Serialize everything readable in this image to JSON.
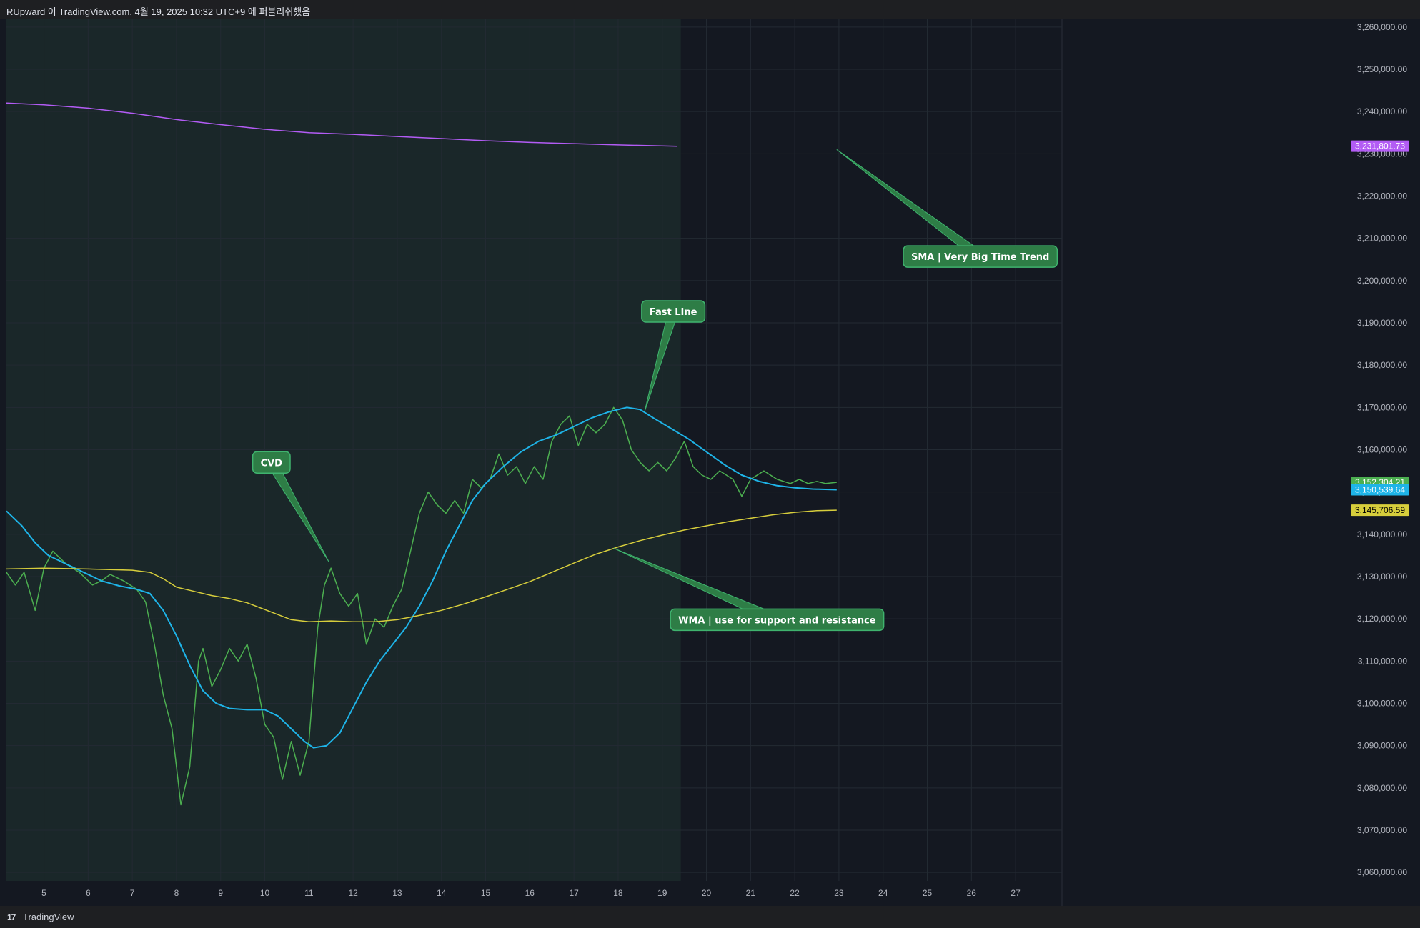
{
  "header": {
    "title": "RUpward 이 TradingView.com, 4월 19, 2025 10:32 UTC+9 에 퍼블리쉬했음"
  },
  "footer": {
    "brand": "TradingView",
    "logo": "17"
  },
  "colors": {
    "background": "#141821",
    "highlight": "#1a2729",
    "sma": "#b35cf5",
    "fast": "#1eb4e8",
    "wma": "#d7ce3c",
    "cvd": "#4caf50",
    "callout": "#2e7d46",
    "callout_border": "#3fb36e"
  },
  "chart_data": {
    "type": "line",
    "title": "",
    "xlabel": "",
    "ylabel": "",
    "x_ticks": [
      "5",
      "6",
      "7",
      "8",
      "9",
      "10",
      "11",
      "12",
      "13",
      "14",
      "15",
      "16",
      "17",
      "18",
      "19",
      "20",
      "21",
      "22",
      "23",
      "24",
      "25",
      "26",
      "27"
    ],
    "x_range": [
      4.15,
      28.05
    ],
    "y_range": [
      3058000,
      3262000
    ],
    "y_ticks": [
      3060000,
      3070000,
      3080000,
      3090000,
      3100000,
      3110000,
      3120000,
      3130000,
      3140000,
      3150000,
      3160000,
      3170000,
      3180000,
      3190000,
      3200000,
      3210000,
      3220000,
      3230000,
      3240000,
      3250000,
      3260000
    ],
    "y_tick_labels": [
      "3,060,000.00",
      "3,070,000.00",
      "3,080,000.00",
      "3,090,000.00",
      "3,100,000.00",
      "3,110,000.00",
      "3,120,000.00",
      "3,130,000.00",
      "3,140,000.00",
      "3,150,000.00",
      "3,160,000.00",
      "3,170,000.00",
      "3,180,000.00",
      "3,190,000.00",
      "3,200,000.00",
      "3,210,000.00",
      "3,220,000.00",
      "3,230,000.00",
      "3,240,000.00",
      "3,250,000.00",
      "3,260,000.00"
    ],
    "highlight_range": [
      4.15,
      19.42
    ],
    "grid": true,
    "series": [
      {
        "key": "sma",
        "color": "#b35cf5",
        "last_label": "3,231,801.73",
        "last_value": 3231801.73,
        "points": [
          [
            4.15,
            3242000
          ],
          [
            5.0,
            3241600
          ],
          [
            6.0,
            3240800
          ],
          [
            7.0,
            3239600
          ],
          [
            8.0,
            3238100
          ],
          [
            9.0,
            3236900
          ],
          [
            10.0,
            3235800
          ],
          [
            11.0,
            3235000
          ],
          [
            12.0,
            3234600
          ],
          [
            13.0,
            3234100
          ],
          [
            14.0,
            3233600
          ],
          [
            15.0,
            3233100
          ],
          [
            16.0,
            3232700
          ],
          [
            17.0,
            3232400
          ],
          [
            18.0,
            3232100
          ],
          [
            19.33,
            3231800
          ]
        ]
      },
      {
        "key": "cvd",
        "color": "#4caf50",
        "last_label": "3,152,304.21",
        "last_value": 3152304.21,
        "points": [
          [
            4.15,
            3131000
          ],
          [
            4.35,
            3128000
          ],
          [
            4.55,
            3131000
          ],
          [
            4.8,
            3122000
          ],
          [
            5.0,
            3132000
          ],
          [
            5.2,
            3136000
          ],
          [
            5.5,
            3133000
          ],
          [
            5.8,
            3131000
          ],
          [
            6.1,
            3128000
          ],
          [
            6.3,
            3129000
          ],
          [
            6.5,
            3130500
          ],
          [
            6.8,
            3129000
          ],
          [
            7.1,
            3127000
          ],
          [
            7.3,
            3124000
          ],
          [
            7.5,
            3114000
          ],
          [
            7.7,
            3102000
          ],
          [
            7.9,
            3094000
          ],
          [
            8.1,
            3076000
          ],
          [
            8.3,
            3085000
          ],
          [
            8.5,
            3110000
          ],
          [
            8.6,
            3113000
          ],
          [
            8.8,
            3104000
          ],
          [
            9.0,
            3108000
          ],
          [
            9.2,
            3113000
          ],
          [
            9.4,
            3110000
          ],
          [
            9.6,
            3114000
          ],
          [
            9.8,
            3106000
          ],
          [
            10.0,
            3095000
          ],
          [
            10.2,
            3092000
          ],
          [
            10.4,
            3082000
          ],
          [
            10.6,
            3091000
          ],
          [
            10.8,
            3083000
          ],
          [
            11.0,
            3091000
          ],
          [
            11.2,
            3118000
          ],
          [
            11.35,
            3128000
          ],
          [
            11.5,
            3132000
          ],
          [
            11.7,
            3126000
          ],
          [
            11.9,
            3123000
          ],
          [
            12.1,
            3126000
          ],
          [
            12.3,
            3114000
          ],
          [
            12.5,
            3120000
          ],
          [
            12.7,
            3118000
          ],
          [
            12.9,
            3123000
          ],
          [
            13.1,
            3127000
          ],
          [
            13.3,
            3136000
          ],
          [
            13.5,
            3145000
          ],
          [
            13.7,
            3150000
          ],
          [
            13.9,
            3147000
          ],
          [
            14.1,
            3145000
          ],
          [
            14.3,
            3148000
          ],
          [
            14.5,
            3145000
          ],
          [
            14.7,
            3153000
          ],
          [
            14.9,
            3151000
          ],
          [
            15.1,
            3153000
          ],
          [
            15.3,
            3159000
          ],
          [
            15.5,
            3154000
          ],
          [
            15.7,
            3156000
          ],
          [
            15.9,
            3152000
          ],
          [
            16.1,
            3156000
          ],
          [
            16.3,
            3153000
          ],
          [
            16.5,
            3162000
          ],
          [
            16.7,
            3166000
          ],
          [
            16.9,
            3168000
          ],
          [
            17.1,
            3161000
          ],
          [
            17.3,
            3166000
          ],
          [
            17.5,
            3164000
          ],
          [
            17.7,
            3166000
          ],
          [
            17.9,
            3170000
          ],
          [
            18.1,
            3167000
          ],
          [
            18.3,
            3160000
          ],
          [
            18.5,
            3157000
          ],
          [
            18.7,
            3155000
          ],
          [
            18.9,
            3157000
          ],
          [
            19.1,
            3155000
          ],
          [
            19.3,
            3158000
          ],
          [
            19.5,
            3162000
          ],
          [
            19.7,
            3156000
          ],
          [
            19.9,
            3154000
          ],
          [
            20.1,
            3153000
          ],
          [
            20.3,
            3155000
          ],
          [
            20.6,
            3153000
          ],
          [
            20.8,
            3149000
          ],
          [
            21.0,
            3153000
          ],
          [
            21.3,
            3155000
          ],
          [
            21.6,
            3153000
          ],
          [
            21.9,
            3152000
          ],
          [
            22.1,
            3153000
          ],
          [
            22.3,
            3152000
          ],
          [
            22.5,
            3152500
          ],
          [
            22.7,
            3152000
          ],
          [
            22.95,
            3152300
          ]
        ]
      },
      {
        "key": "fast",
        "color": "#1eb4e8",
        "last_label": "3,150,539.64",
        "last_value": 3150539.64,
        "points": [
          [
            4.15,
            3145500
          ],
          [
            4.5,
            3142000
          ],
          [
            4.8,
            3138000
          ],
          [
            5.1,
            3135000
          ],
          [
            5.5,
            3133000
          ],
          [
            5.9,
            3131000
          ],
          [
            6.3,
            3129000
          ],
          [
            6.7,
            3127800
          ],
          [
            7.1,
            3127000
          ],
          [
            7.4,
            3126000
          ],
          [
            7.7,
            3122000
          ],
          [
            8.0,
            3116000
          ],
          [
            8.3,
            3109000
          ],
          [
            8.6,
            3103000
          ],
          [
            8.9,
            3100000
          ],
          [
            9.2,
            3098800
          ],
          [
            9.6,
            3098500
          ],
          [
            10.0,
            3098500
          ],
          [
            10.3,
            3097000
          ],
          [
            10.6,
            3094000
          ],
          [
            10.9,
            3091000
          ],
          [
            11.1,
            3089500
          ],
          [
            11.4,
            3090000
          ],
          [
            11.7,
            3093000
          ],
          [
            12.0,
            3099000
          ],
          [
            12.3,
            3105000
          ],
          [
            12.6,
            3110000
          ],
          [
            12.9,
            3114000
          ],
          [
            13.2,
            3118000
          ],
          [
            13.5,
            3123000
          ],
          [
            13.8,
            3129000
          ],
          [
            14.1,
            3136000
          ],
          [
            14.4,
            3142000
          ],
          [
            14.7,
            3148000
          ],
          [
            15.0,
            3152000
          ],
          [
            15.4,
            3156000
          ],
          [
            15.8,
            3159500
          ],
          [
            16.2,
            3162000
          ],
          [
            16.6,
            3163500
          ],
          [
            17.0,
            3165500
          ],
          [
            17.4,
            3167500
          ],
          [
            17.8,
            3169000
          ],
          [
            18.2,
            3170000
          ],
          [
            18.5,
            3169500
          ],
          [
            18.8,
            3167500
          ],
          [
            19.2,
            3165000
          ],
          [
            19.6,
            3162500
          ],
          [
            20.0,
            3159500
          ],
          [
            20.4,
            3156500
          ],
          [
            20.8,
            3154000
          ],
          [
            21.2,
            3152500
          ],
          [
            21.6,
            3151500
          ],
          [
            22.0,
            3151000
          ],
          [
            22.4,
            3150700
          ],
          [
            22.95,
            3150540
          ]
        ]
      },
      {
        "key": "wma",
        "color": "#d7ce3c",
        "last_label": "3,145,706.59",
        "last_value": 3145706.59,
        "points": [
          [
            4.15,
            3131800
          ],
          [
            5.0,
            3132000
          ],
          [
            6.0,
            3131800
          ],
          [
            7.0,
            3131500
          ],
          [
            7.4,
            3131000
          ],
          [
            7.7,
            3129500
          ],
          [
            8.0,
            3127500
          ],
          [
            8.4,
            3126500
          ],
          [
            8.8,
            3125500
          ],
          [
            9.2,
            3124800
          ],
          [
            9.6,
            3123800
          ],
          [
            10.0,
            3122200
          ],
          [
            10.3,
            3121000
          ],
          [
            10.6,
            3119800
          ],
          [
            11.0,
            3119300
          ],
          [
            11.5,
            3119500
          ],
          [
            12.0,
            3119300
          ],
          [
            12.5,
            3119300
          ],
          [
            13.0,
            3119800
          ],
          [
            13.5,
            3120800
          ],
          [
            14.0,
            3122000
          ],
          [
            14.5,
            3123500
          ],
          [
            15.0,
            3125200
          ],
          [
            15.5,
            3127000
          ],
          [
            16.0,
            3128800
          ],
          [
            16.5,
            3131000
          ],
          [
            17.0,
            3133200
          ],
          [
            17.5,
            3135300
          ],
          [
            18.0,
            3137000
          ],
          [
            18.5,
            3138500
          ],
          [
            19.0,
            3139800
          ],
          [
            19.5,
            3141000
          ],
          [
            20.0,
            3142000
          ],
          [
            20.5,
            3143000
          ],
          [
            21.0,
            3143800
          ],
          [
            21.5,
            3144600
          ],
          [
            22.0,
            3145200
          ],
          [
            22.5,
            3145600
          ],
          [
            22.95,
            3145706
          ]
        ]
      }
    ],
    "annotations": [
      {
        "key": "cvd",
        "text": "CVD",
        "tip": [
          11.45,
          3133500
        ],
        "box_center": [
          10.15,
          3157000
        ]
      },
      {
        "key": "fast",
        "text": "Fast LIne",
        "tip": [
          18.6,
          3169000
        ],
        "box_center": [
          19.25,
          3192700
        ]
      },
      {
        "key": "sma",
        "text": "SMA | Very Big  Time Trend",
        "tip": [
          22.95,
          3231000
        ],
        "box_center": [
          26.2,
          3205700
        ]
      },
      {
        "key": "wma",
        "text": "WMA | use for  support and resistance",
        "tip": [
          17.9,
          3136700
        ],
        "box_center": [
          21.6,
          3119800
        ]
      }
    ]
  }
}
